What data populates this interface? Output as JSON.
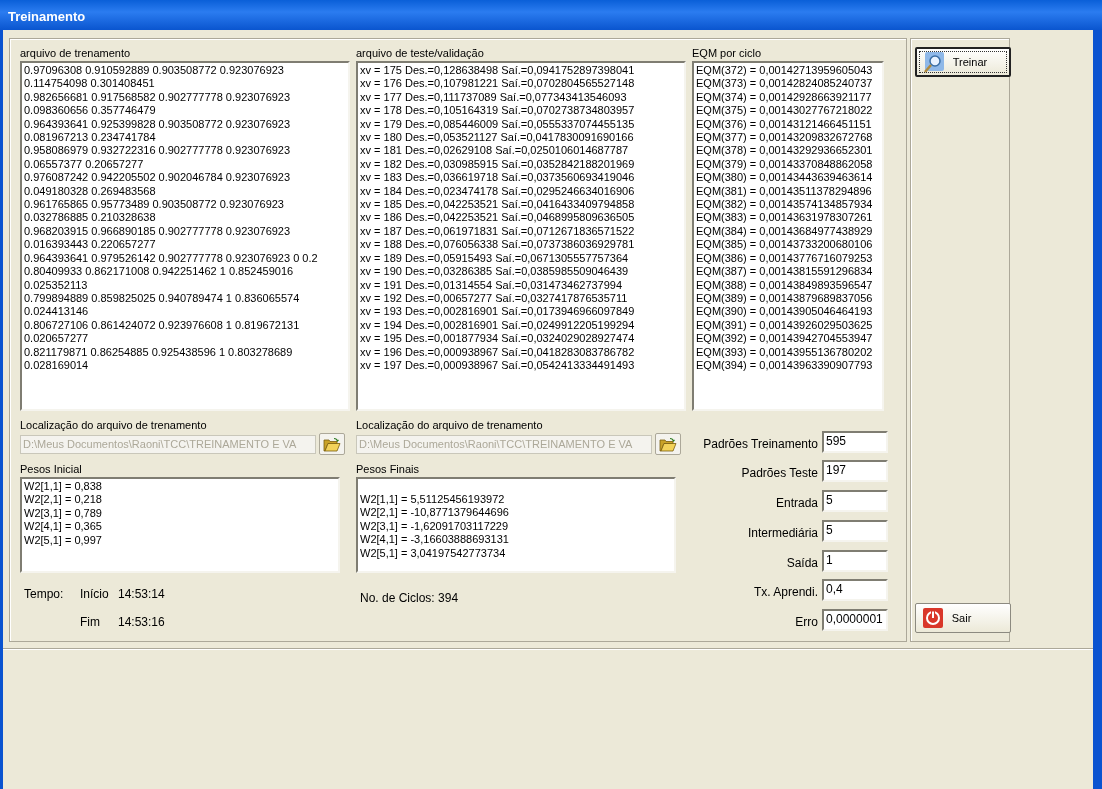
{
  "window": {
    "title": "Treinamento"
  },
  "panels": [
    {
      "label": "arquivo de trenamento",
      "lines": [
        "0.97096308 0.910592889 0.903508772 0.923076923",
        "0.114754098 0.301408451",
        "0.982656681 0.917568582 0.902777778 0.923076923",
        "0.098360656 0.357746479",
        "0.964393641 0.925399828 0.903508772 0.923076923",
        "0.081967213 0.234741784",
        "0.958086979 0.932722316 0.902777778 0.923076923",
        "0.06557377 0.20657277",
        "0.976087242 0.942205502 0.902046784 0.923076923",
        "0.049180328 0.269483568",
        "0.961765865 0.95773489 0.903508772 0.923076923",
        "0.032786885 0.210328638",
        "0.968203915 0.966890185 0.902777778 0.923076923",
        "0.016393443 0.220657277",
        "0.964393641 0.979526142 0.902777778 0.923076923 0 0.2",
        "0.80409933 0.862171008 0.942251462 1 0.852459016",
        "0.025352113",
        "0.799894889 0.859825025 0.940789474 1 0.836065574",
        "0.024413146",
        "0.806727106 0.861424072 0.923976608 1 0.819672131",
        "0.020657277",
        "0.821179871 0.86254885 0.925438596 1 0.803278689",
        "0.028169014"
      ]
    },
    {
      "label": "arquivo de teste/validação",
      "lines": [
        "xv = 175 Des.=0,128638498 Saí.=0,0941752897398041",
        "xv = 176 Des.=0,107981221 Saí.=0,0702804565527148",
        "xv = 177 Des.=0,111737089 Saí.=0,077343413546093",
        "xv = 178 Des.=0,105164319 Saí.=0,0702738734803957",
        "xv = 179 Des.=0,085446009 Saí.=0,0555337074455135",
        "xv = 180 Des.=0,053521127 Saí.=0,0417830091690166",
        "xv = 181 Des.=0,02629108 Saí.=0,0250106014687787",
        "xv = 182 Des.=0,030985915 Saí.=0,0352842188201969",
        "xv = 183 Des.=0,036619718 Saí.=0,0373560693419046",
        "xv = 184 Des.=0,023474178 Saí.=0,0295246634016906",
        "xv = 185 Des.=0,042253521 Saí.=0,0416433409794858",
        "xv = 186 Des.=0,042253521 Saí.=0,0468995809636505",
        "xv = 187 Des.=0,061971831 Saí.=0,0712671836571522",
        "xv = 188 Des.=0,076056338 Saí.=0,0737386036929781",
        "xv = 189 Des.=0,05915493 Saí.=0,0671305557757364",
        "xv = 190 Des.=0,03286385 Saí.=0,0385985509046439",
        "xv = 191 Des.=0,01314554 Saí.=0,031473462737994",
        "xv = 192 Des.=0,00657277 Saí.=0,0327417876535711",
        "xv = 193 Des.=0,002816901 Saí.=0,0173946966097849",
        "xv = 194 Des.=0,002816901 Saí.=0,0249912205199294",
        "xv = 195 Des.=0,001877934 Saí.=0,0324029028927474",
        "xv = 196 Des.=0,000938967 Saí.=0,0418283083786782",
        "xv = 197 Des.=0,000938967 Saí.=0,0542413334491493"
      ]
    },
    {
      "label": "EQM por ciclo",
      "lines": [
        "EQM(372) = 0,00142713959605043",
        "EQM(373) = 0,00142824085240737",
        "EQM(374) = 0,00142928663921177",
        "EQM(375) = 0,00143027767218022",
        "EQM(376) = 0,00143121466451151",
        "EQM(377) = 0,00143209832672768",
        "EQM(378) = 0,00143292936652301",
        "EQM(379) = 0,00143370848862058",
        "EQM(380) = 0,00143443639463614",
        "EQM(381) = 0,00143511378294896",
        "EQM(382) = 0,00143574134857934",
        "EQM(383) = 0,00143631978307261",
        "EQM(384) = 0,00143684977438929",
        "EQM(385) = 0,00143733200680106",
        "EQM(386) = 0,00143776716079253",
        "EQM(387) = 0,00143815591296834",
        "EQM(388) = 0,00143849893596547",
        "EQM(389) = 0,00143879689837056",
        "EQM(390) = 0,00143905046464193",
        "EQM(391) = 0,00143926029503625",
        "EQM(392) = 0,00143942704553947",
        "EQM(393) = 0,00143955136780202",
        "EQM(394) = 0,00143963390907793"
      ]
    }
  ],
  "file_pickers": [
    {
      "label": "Localização do arquivo de trenamento",
      "value": "D:\\Meus Documentos\\Raoni\\TCC\\TREINAMENTO E VA",
      "disabled": true
    },
    {
      "label": "Localização do arquivo de trenamento",
      "value": "D:\\Meus Documentos\\Raoni\\TCC\\TREINAMENTO E VA",
      "disabled": true
    }
  ],
  "weights": [
    {
      "label": "Pesos Inicial",
      "lines": [
        "W2[1,1] = 0,838",
        "W2[2,1] = 0,218",
        "W2[3,1] = 0,789",
        "W2[4,1] = 0,365",
        "W2[5,1] = 0,997"
      ]
    },
    {
      "label": "Pesos Finais",
      "lines": [
        "W2[1,1] = 5,51125456193972",
        "W2[2,1] = -10,8771379644696",
        "W2[3,1] = -1,62091703117229",
        "W2[4,1] = -3,16603888693131",
        "W2[5,1] = 3,04197542773734"
      ]
    }
  ],
  "time": {
    "label": "Tempo:",
    "start_label": "Início",
    "start": "14:53:14",
    "end_label": "Fim",
    "end": "14:53:16"
  },
  "cycles": "No. de Ciclos: 394",
  "parameters": [
    {
      "label": "Padrões Treinamento",
      "value": "595"
    },
    {
      "label": "Padrões Teste",
      "value": "197"
    },
    {
      "label": "Entrada",
      "value": "5"
    },
    {
      "label": "Intermediária",
      "value": "5"
    },
    {
      "label": "Saída",
      "value": "1"
    },
    {
      "label": "Tx. Aprendi.",
      "value": "0,4"
    },
    {
      "label": "Erro",
      "value": "0,0000001"
    }
  ],
  "buttons": [
    {
      "label": "Treinar",
      "kind": "train",
      "focused": true
    },
    {
      "label": "Sair",
      "kind": "exit",
      "focused": false
    }
  ]
}
